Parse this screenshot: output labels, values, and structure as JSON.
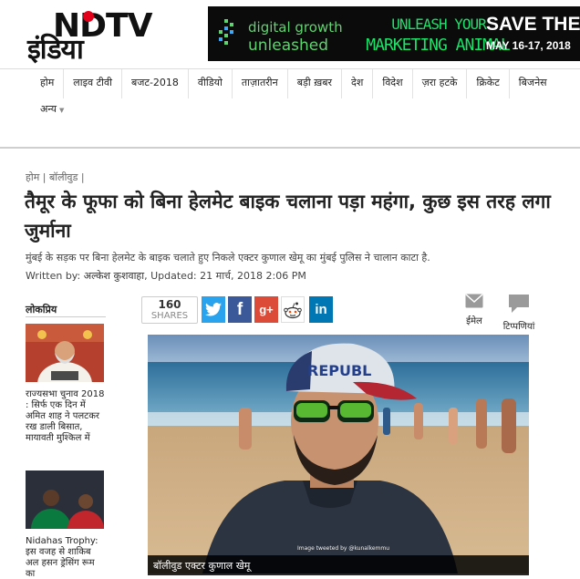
{
  "logo": {
    "top": "NDTV",
    "bottom": "इंडिया"
  },
  "ad": {
    "brand_line1": "digital growth",
    "brand_line2": "unleashed",
    "tagline_line1": "UNLEASH YOUR",
    "tagline_line2": "MARKETING ANIMAL",
    "cta": "SAVE THE",
    "dates": "MAY 16-17, 2018"
  },
  "nav": {
    "items": [
      "होम",
      "लाइव टीवी",
      "बजट-2018",
      "वीडियो",
      "ताज़ातरीन",
      "बड़ी ख़बर",
      "देश",
      "विदेश",
      "ज़रा हटके",
      "क्रिकेट",
      "बिजनेस"
    ],
    "more": "अन्य"
  },
  "breadcrumb": {
    "home": "होम",
    "section": "बॉलीवुड"
  },
  "article": {
    "headline": "तैमूर के फूफा को बिना हेलमेट बाइक चलाना पड़ा महंगा, कुछ इस तरह लगा जुर्माना",
    "summary": "मुंबई के सड़क पर बिना हेलमेट के बाइक चलाते हुए निकले एक्टर कुणाल खेमू का मुंबई पुलिस ने चालान काटा है.",
    "byline_prefix": "Written by:",
    "author": "अल्केश कुशवाहा",
    "updated": ", Updated: 21 मार्च, 2018 2:06 PM"
  },
  "share": {
    "count": "160",
    "count_label": "SHARES",
    "buttons": [
      {
        "icon": "twitter-icon",
        "color": "#2aa3ef"
      },
      {
        "icon": "facebook-icon",
        "color": "#3b5998"
      },
      {
        "icon": "google-plus-icon",
        "color": "#dc4a38"
      },
      {
        "icon": "reddit-icon",
        "color": "#ffffff"
      },
      {
        "icon": "linkedin-icon",
        "color": "#0077b5"
      }
    ],
    "email_label": "ईमेल",
    "comments_label": "टिप्पणियां"
  },
  "sidebar": {
    "title": "लोकप्रिय",
    "items": [
      {
        "text": "राज्यसभा चुनाव 2018 : सिर्फ एक दिन में अमित शाह ने पलटकर रख डाली बिसात, मायावती मुश्किल में"
      },
      {
        "text": "Nidahas Trophy: इस वजह से शाकिब अल हसन ड्रेसिंग रूम का"
      }
    ]
  },
  "hero": {
    "caption": "बॉलीवुड एक्टर कुणाल खेमू",
    "credit": "Image tweeted by @kunalkemmu",
    "cap_text": "REPUBL"
  }
}
